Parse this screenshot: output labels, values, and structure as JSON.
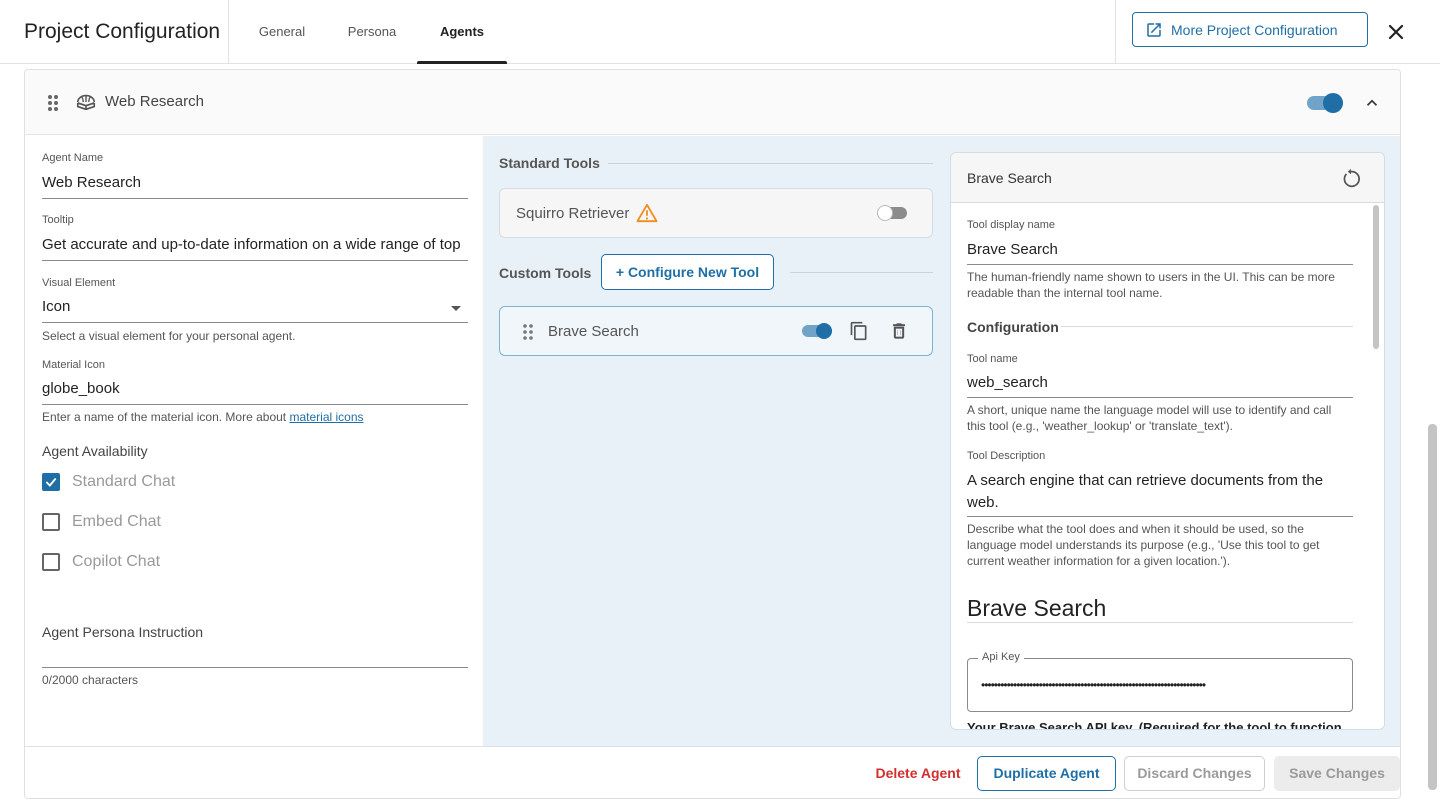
{
  "header": {
    "title": "Project Configuration",
    "tabs": [
      {
        "label": "General",
        "active": false
      },
      {
        "label": "Persona",
        "active": false
      },
      {
        "label": "Agents",
        "active": true
      }
    ],
    "more_button": "More Project Configuration"
  },
  "agent": {
    "title": "Web Research",
    "icon": "globe-book-icon",
    "enabled": true,
    "fields": {
      "name_label": "Agent Name",
      "name_value": "Web Research",
      "tooltip_label": "Tooltip",
      "tooltip_value": "Get accurate and up-to-date information on a wide range of top",
      "visual_label": "Visual Element",
      "visual_value": "Icon",
      "visual_hint": "Select a visual element for your personal agent.",
      "material_label": "Material Icon",
      "material_value": "globe_book",
      "material_hint": "Enter a name of the material icon. More about",
      "material_link": "material icons"
    },
    "availability": {
      "label": "Agent Availability",
      "options": [
        {
          "label": "Standard Chat",
          "checked": true
        },
        {
          "label": "Embed Chat",
          "checked": false
        },
        {
          "label": "Copilot Chat",
          "checked": false
        }
      ]
    },
    "persona": {
      "label": "Agent Persona Instruction",
      "counter": "0/2000 characters"
    }
  },
  "tools": {
    "standard_heading": "Standard Tools",
    "standard": [
      {
        "name": "Squirro Retriever",
        "warning": true,
        "enabled": false
      }
    ],
    "custom_heading": "Custom Tools",
    "configure_button": "+ Configure New Tool",
    "custom": [
      {
        "name": "Brave Search",
        "enabled": true
      }
    ]
  },
  "detail": {
    "title": "Brave Search",
    "display_name_label": "Tool display name",
    "display_name_value": "Brave Search",
    "display_name_hint": "The human-friendly name shown to users in the UI. This can be more readable than the internal tool name.",
    "config_heading": "Configuration",
    "tool_name_label": "Tool name",
    "tool_name_value": "web_search",
    "tool_name_hint": "A short, unique name the language model will use to identify and call this tool (e.g., 'weather_lookup' or 'translate_text').",
    "desc_label": "Tool Description",
    "desc_value": "A search engine that can retrieve documents from the web.",
    "desc_hint": "Describe what the tool does and when it should be used, so the language model understands its purpose (e.g., 'Use this tool to get current weather information for a given location.').",
    "section_heading": "Brave Search",
    "api_label": "Api Key",
    "api_value": "••••••••••••••••••••••••••••••••••••••••••••••••••••••••••••••••••••••",
    "api_hint": "Your Brave Search API key. (Required for the tool to function."
  },
  "footer": {
    "delete": "Delete Agent",
    "duplicate": "Duplicate Agent",
    "discard": "Discard Changes",
    "save": "Save Changes"
  },
  "colors": {
    "accent": "#1f6fa6",
    "danger": "#d32f2f",
    "warning": "#f08c1c",
    "tools_bg": "#e8f1f7"
  }
}
